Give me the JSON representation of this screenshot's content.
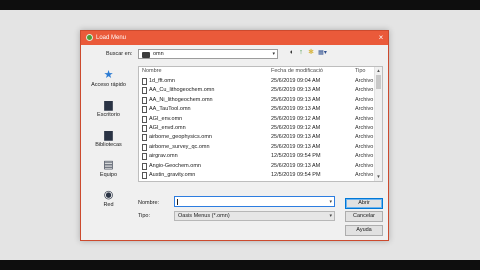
{
  "dialog": {
    "title": "Load Menu",
    "close_glyph": "×"
  },
  "lookin": {
    "label": "Buscar en:",
    "value": "omn",
    "icon": "folder-icon",
    "arrow": "▾"
  },
  "toolbar": {
    "back": "◐",
    "up": "↑",
    "new_folder": "✱",
    "view": "▦▾"
  },
  "places": [
    {
      "label": "Acceso rápido",
      "icon": "star-icon",
      "glyph": "★",
      "color": "#2b7bd3"
    },
    {
      "label": "Escritorio",
      "icon": "desktop-icon",
      "glyph": "▆",
      "color": "#2a3344"
    },
    {
      "label": "Bibliotecas",
      "icon": "libraries-icon",
      "glyph": "▆",
      "color": "#2a3344"
    },
    {
      "label": "Equipo",
      "icon": "computer-icon",
      "glyph": "▤",
      "color": "#2a3344"
    },
    {
      "label": "Red",
      "icon": "network-icon",
      "glyph": "◉",
      "color": "#2a3344"
    }
  ],
  "list": {
    "headers": {
      "name": "Nombre",
      "date": "Fecha de modificación",
      "type": "Tipo"
    },
    "files": [
      {
        "name": "1d_fft.omn",
        "date": "25/6/2019 09:04 AM",
        "type": "Archivo"
      },
      {
        "name": "AA_Cu_lithogeochem.omn",
        "date": "25/6/2019 09:13 AM",
        "type": "Archivo"
      },
      {
        "name": "AA_Ni_lithogeochem.omn",
        "date": "25/6/2019 09:13 AM",
        "type": "Archivo"
      },
      {
        "name": "AA_TauTool.omn",
        "date": "25/6/2019 09:13 AM",
        "type": "Archivo"
      },
      {
        "name": "AGI_env.omn",
        "date": "25/6/2019 09:12 AM",
        "type": "Archivo"
      },
      {
        "name": "AGI_envd.omn",
        "date": "25/6/2019 09:12 AM",
        "type": "Archivo"
      },
      {
        "name": "airborne_geophysics.omn",
        "date": "25/6/2019 09:13 AM",
        "type": "Archivo"
      },
      {
        "name": "airborne_survey_qc.omn",
        "date": "25/6/2019 09:13 AM",
        "type": "Archivo"
      },
      {
        "name": "airgrav.omn",
        "date": "12/5/2019 09:54 PM",
        "type": "Archivo"
      },
      {
        "name": "Angio-Geochem.omn",
        "date": "25/6/2019 09:13 AM",
        "type": "Archivo"
      },
      {
        "name": "Austin_gravity.omn",
        "date": "12/5/2019 09:54 PM",
        "type": "Archivo"
      }
    ],
    "scroll_up": "▲",
    "scroll_down": "▼"
  },
  "form": {
    "name_label": "Nombre:",
    "name_value": "",
    "name_arrow": "▾",
    "type_label": "Tipo:",
    "type_value": "Oasis Menus (*.omn)",
    "type_arrow": "▾"
  },
  "buttons": {
    "open": "Abrir",
    "cancel": "Cancelar",
    "help": "Ayuda"
  },
  "colors": {
    "titlebar": "#ea5a3a",
    "accent": "#0078d7"
  }
}
